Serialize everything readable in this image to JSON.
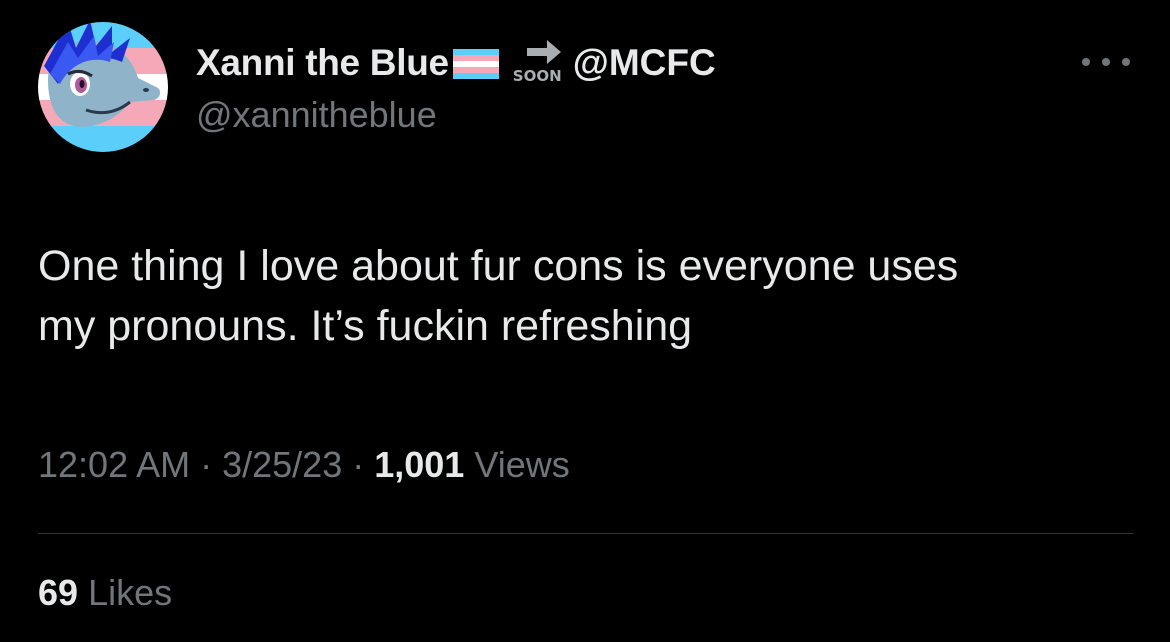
{
  "author": {
    "display_name": "Xanni the Blue",
    "flag_icon": "transgender-flag-icon",
    "soon_label": "SOON",
    "linked_handle": "@MCFC",
    "username": "@xannitheblue",
    "avatar_icon": "blue-dragon-avatar"
  },
  "tweet": {
    "text_lines": [
      "One thing I love about fur cons is everyone uses",
      "my pronouns. It’s fuckin refreshing"
    ]
  },
  "meta": {
    "time": "12:02 AM",
    "separator": " · ",
    "date": "3/25/23",
    "views_count": "1,001",
    "views_label": "Views"
  },
  "engagement": {
    "likes_count": "69",
    "likes_label": "Likes"
  },
  "colors": {
    "background": "#000000",
    "primary_text": "#e7e9ea",
    "secondary_text": "#71767b",
    "divider": "#2f3336",
    "trans_blue": "#5bcefa",
    "trans_pink": "#f5a9b8",
    "trans_white": "#ffffff"
  }
}
